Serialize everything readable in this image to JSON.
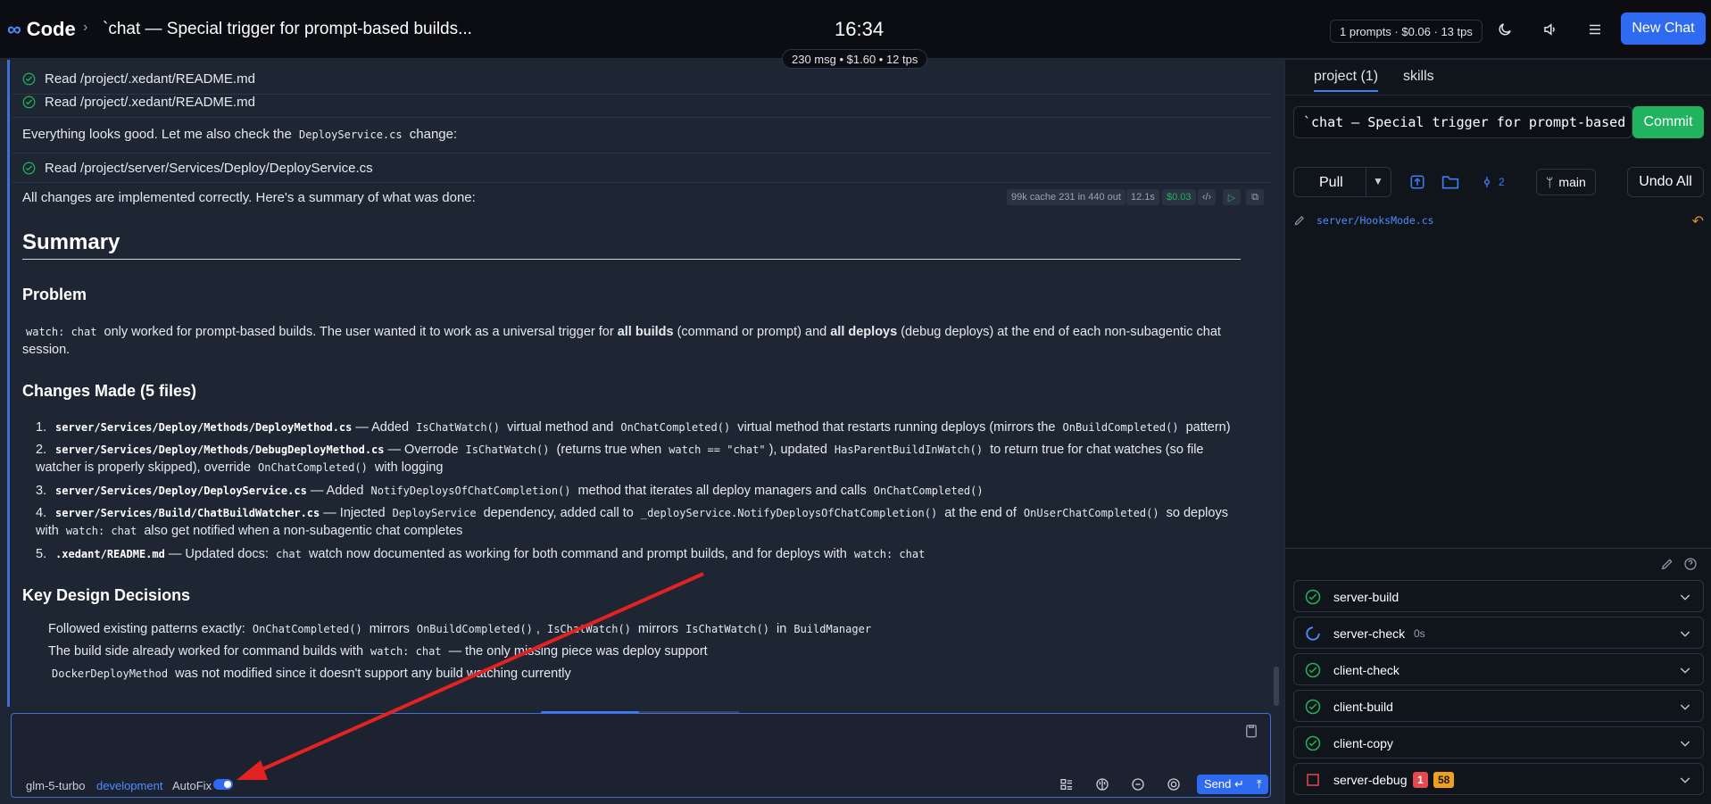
{
  "app": {
    "name": "Code",
    "chat_title": "`chat — Special trigger for prompt-based builds...",
    "clock": "16:34",
    "stats": "1 prompts · $0.06 · 13 tps",
    "new_chat": "New Chat",
    "msg_stats": "230 msg • $1.60 • 12 tps"
  },
  "tools": [
    {
      "label": "Read /project/.xedant/README.md"
    },
    {
      "label": "Read /project/.xedant/README.md"
    },
    {
      "label": "Read /project/server/Services/Deploy/DeployService.cs"
    }
  ],
  "messages": {
    "check_pre": "Everything looks good. Let me also check the",
    "check_code": "DeployService.cs",
    "check_post": "change:",
    "summary_intro": "All changes are implemented correctly. Here's a summary of what was done:",
    "meta": {
      "tokens": "99k cache 231 in 440 out",
      "time": "12.1s",
      "cost": "$0.03"
    }
  },
  "summary": {
    "title": "Summary",
    "problem_heading": "Problem",
    "problem": {
      "code": "watch: chat",
      "t1": "only worked for prompt-based builds. The user wanted it to work as a universal trigger for",
      "b1": "all builds",
      "t2": "(command or prompt) and",
      "b2": "all deploys",
      "t3": "(debug deploys) at the end of each non-subagentic chat",
      "t4": "session."
    },
    "changes_heading": "Changes Made (5 files)",
    "changes": [
      {
        "num": "1.",
        "file": "server/Services/Deploy/Methods/DeployMethod.cs",
        "t1": "— Added",
        "c1": "IsChatWatch()",
        "t2": "virtual method and",
        "c2": "OnChatCompleted()",
        "t3": "virtual method that restarts running deploys (mirrors the",
        "c3": "OnBuildCompleted()",
        "t4": "pattern)"
      },
      {
        "num": "2.",
        "file": "server/Services/Deploy/Methods/DebugDeployMethod.cs",
        "t1": "— Overrode",
        "c1": "IsChatWatch()",
        "t2": "(returns true when",
        "c2": "watch == \"chat\"",
        "t3": "), updated",
        "c3": "HasParentBuildInWatch()",
        "t4": "to return true for chat watches (so file watcher is",
        "t5": "properly skipped), override",
        "c4": "OnChatCompleted()",
        "t6": "with logging"
      },
      {
        "num": "3.",
        "file": "server/Services/Deploy/DeployService.cs",
        "t1": "— Added",
        "c1": "NotifyDeploysOfChatCompletion()",
        "t2": "method that iterates all deploy managers and calls",
        "c2": "OnChatCompleted()"
      },
      {
        "num": "4.",
        "file": "server/Services/Build/ChatBuildWatcher.cs",
        "t1": "— Injected",
        "c1": "DeployService",
        "t2": "dependency, added call to",
        "c2": "_deployService.NotifyDeploysOfChatCompletion()",
        "t3": "at the end of",
        "c3": "OnUserChatCompleted()",
        "t4": "so deploys with",
        "c4": "watch: chat",
        "t5": "also get notified when a non-subagentic chat completes"
      },
      {
        "num": "5.",
        "file": ".xedant/README.md",
        "t1": "— Updated docs:",
        "c1": "chat",
        "t2": "watch now documented as working for both command and prompt builds, and for deploys with",
        "c2": "watch: chat"
      }
    ],
    "decisions_heading": "Key Design Decisions",
    "decisions": [
      {
        "t1": "Followed existing patterns exactly:",
        "c1": "OnChatCompleted()",
        "t2": "mirrors",
        "c2": "OnBuildCompleted()",
        "t3": ",",
        "c3": "IsChatWatch()",
        "t4": "mirrors",
        "c4": "IsChatWatch()",
        "t5": "in",
        "c5": "BuildManager"
      },
      {
        "t1": "The build side already worked for command builds with",
        "c1": "watch: chat",
        "t2": "— the only missing piece was deploy support"
      },
      {
        "c1": "DockerDeployMethod",
        "t1": "was not modified since it doesn't support any build watching currently"
      }
    ]
  },
  "input": {
    "model": "glm-5-turbo",
    "env": "development",
    "autofix": "AutoFix",
    "autofix_on": true,
    "send": "Send ↵"
  },
  "right": {
    "tabs": [
      "project (1)",
      "skills"
    ],
    "commit_message": "`chat — Special trigger for prompt-based",
    "commit": "Commit",
    "pull": "Pull",
    "count": "2",
    "branch": "main",
    "undo_all": "Undo All",
    "changed_file": "server/HooksMode.cs",
    "tasks": [
      {
        "name": "server-build",
        "status": "success"
      },
      {
        "name": "server-check",
        "status": "running",
        "duration": "0s"
      },
      {
        "name": "client-check",
        "status": "success"
      },
      {
        "name": "client-build",
        "status": "success"
      },
      {
        "name": "client-copy",
        "status": "success"
      },
      {
        "name": "server-debug",
        "status": "stopped",
        "errors": "1",
        "warnings": "58"
      }
    ]
  },
  "colors": {
    "accent": "#2f6bf0",
    "success": "#22b35e",
    "error": "#e5484d",
    "warning": "#f0a020"
  }
}
